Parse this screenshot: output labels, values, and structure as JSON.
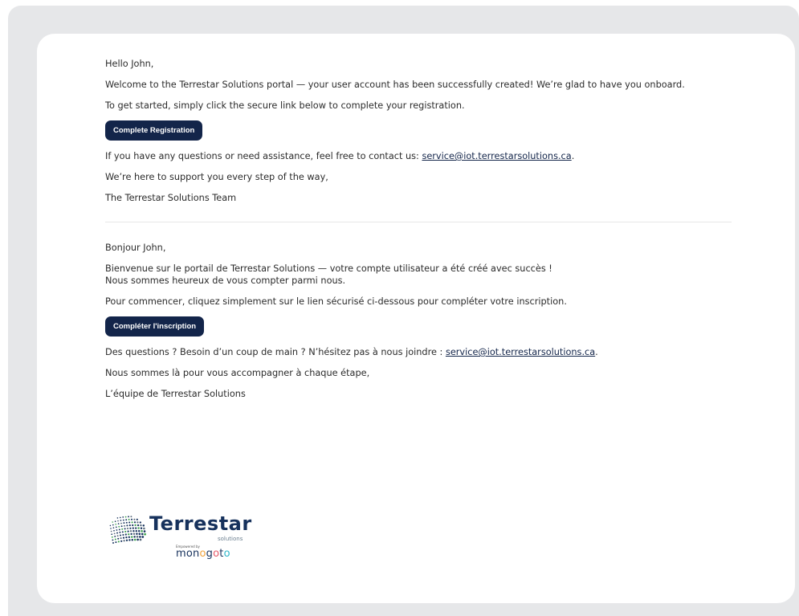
{
  "en": {
    "greeting": "Hello John,",
    "welcome": "Welcome to the Terrestar Solutions portal — your user account has been successfully created! We’re glad to have you onboard.",
    "instructions": "To get started, simply click the secure link below to complete your registration.",
    "button_label": "Complete Registration",
    "contact_prefix": "If you have any questions or need assistance, feel free to contact us: ",
    "contact_email": "service@iot.terrestarsolutions.ca",
    "contact_suffix": ".",
    "support": "We’re here to support you every step of the way,",
    "signature": "The Terrestar Solutions Team"
  },
  "fr": {
    "greeting": "Bonjour John,",
    "welcome_line1": "Bienvenue sur le portail de Terrestar Solutions — votre compte utilisateur a été créé avec succès !",
    "welcome_line2": "Nous sommes heureux de vous compter parmi nous.",
    "instructions": "Pour commencer, cliquez simplement sur le lien sécurisé ci-dessous pour compléter votre inscription.",
    "button_label": "Compléter l'inscription",
    "contact_prefix": "Des questions ? Besoin d’un coup de main ? N’hésitez pas à nous joindre : ",
    "contact_email": "service@iot.terrestarsolutions.ca",
    "contact_suffix": ".",
    "support": "Nous sommes là pour vous accompagner à chaque étape,",
    "signature": "L’équipe de Terrestar Solutions"
  },
  "logo": {
    "wordmark": "Terrestar",
    "sub": "solutions",
    "powered_by": "Empowered by",
    "partner_parts": [
      "m",
      "o",
      "n",
      "o",
      "g",
      "o",
      "t",
      "o"
    ],
    "partner_colors": [
      "#16315c",
      "#16315c",
      "#16315c",
      "#f2a33a",
      "#16315c",
      "#e55a6b",
      "#16315c",
      "#2cb5c9"
    ],
    "brand_color": "#16315c",
    "button_color": "#13254a"
  }
}
